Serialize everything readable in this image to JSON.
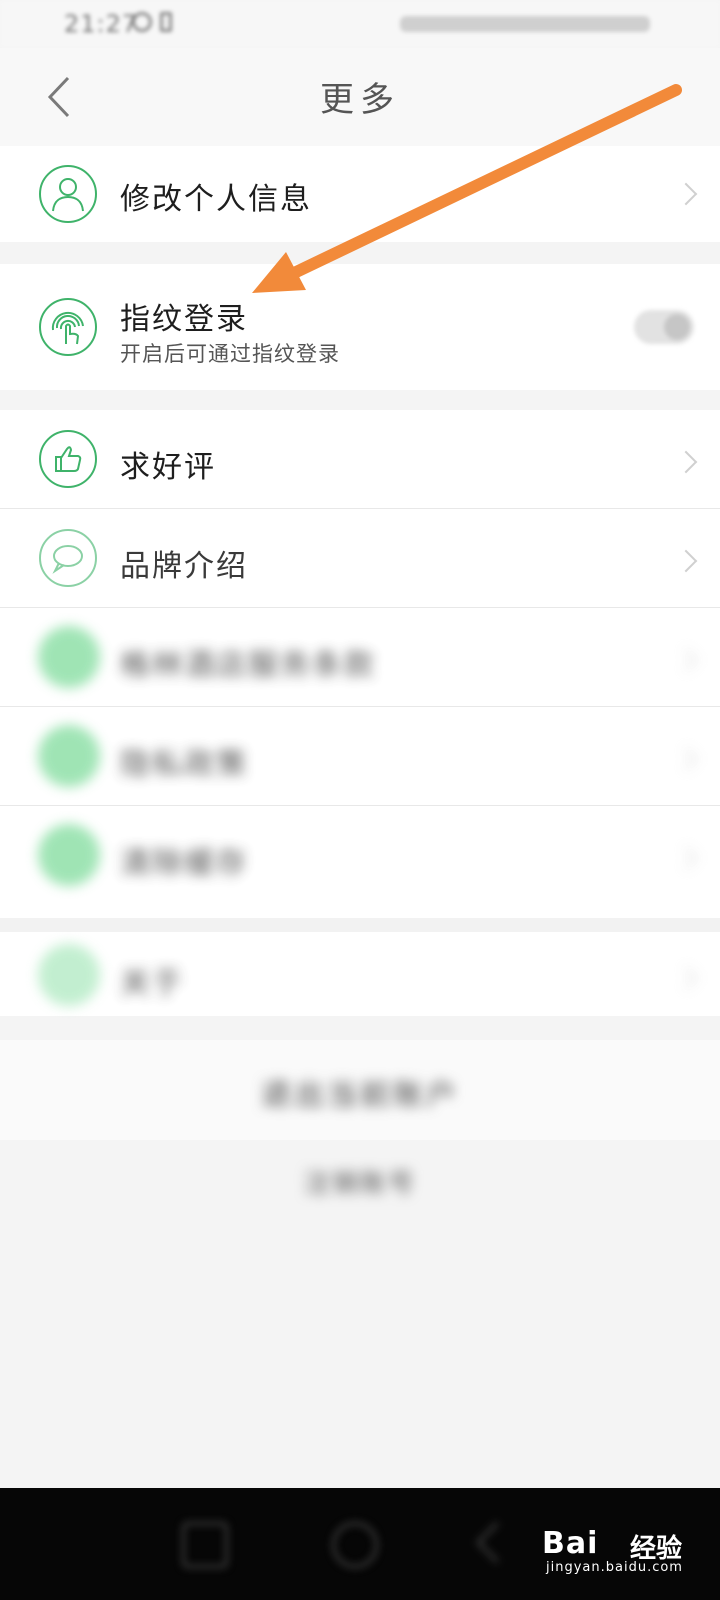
{
  "status_bar": {
    "time": "21:27"
  },
  "header": {
    "title": "更多"
  },
  "groups": {
    "profile": {
      "label": "修改个人信息"
    },
    "fingerprint": {
      "label": "指纹登录",
      "sublabel": "开启后可通过指纹登录",
      "toggle_state": "off"
    },
    "review": {
      "label": "求好评"
    },
    "brand": {
      "label": "品牌介绍"
    },
    "terms": {
      "label": "格林酒店服务条款"
    },
    "row6": {
      "label": "隐私政策"
    },
    "row7": {
      "label": "清除缓存"
    },
    "about": {
      "label": "关于"
    }
  },
  "footer": {
    "logout": "退出当前账户",
    "bottom_link": "注销账号"
  },
  "watermark": {
    "brand": "Bai",
    "cn": "经验",
    "url": "jingyan.baidu.com"
  },
  "colors": {
    "accent": "#3fb36a",
    "arrow": "#f28a3a"
  }
}
